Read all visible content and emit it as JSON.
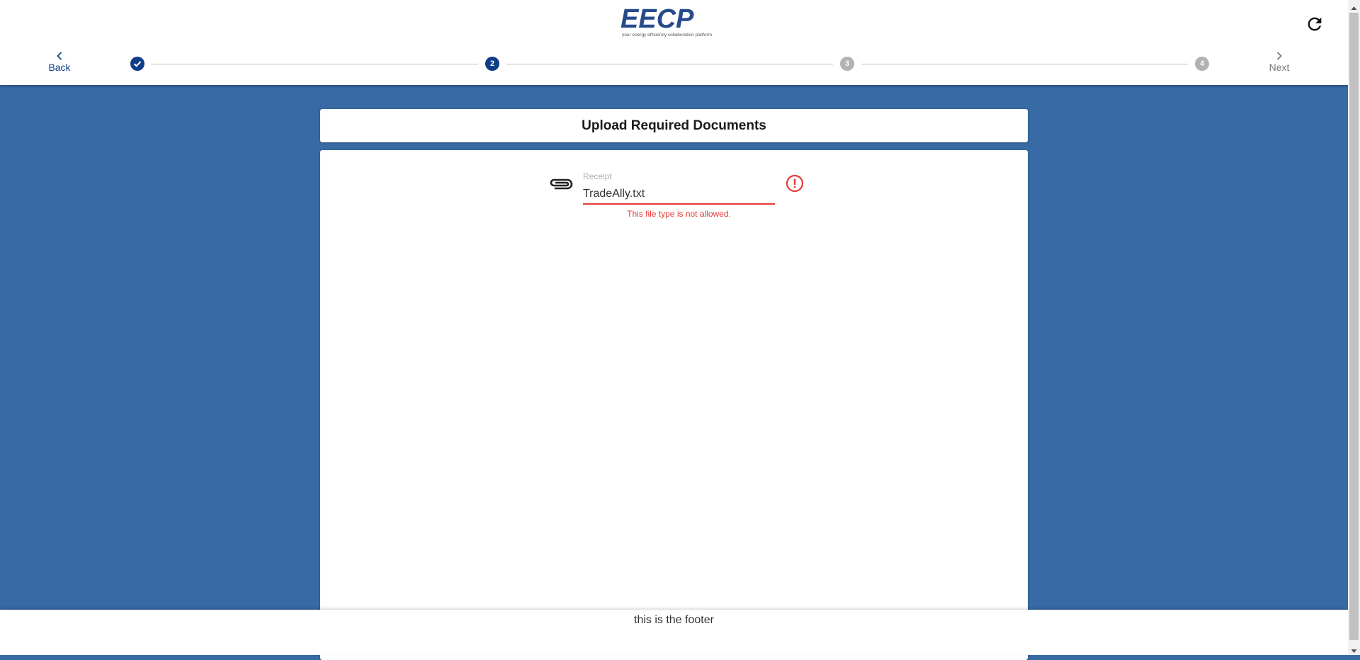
{
  "header": {
    "logo_text": "EECP",
    "logo_tagline": "your energy efficiency collaboration platform",
    "refresh_icon": "refresh-icon"
  },
  "stepper": {
    "back_label": "Back",
    "next_label": "Next",
    "steps": [
      {
        "label": "",
        "state": "done"
      },
      {
        "label": "2",
        "state": "active"
      },
      {
        "label": "3",
        "state": "pending"
      },
      {
        "label": "4",
        "state": "pending"
      }
    ]
  },
  "main": {
    "title": "Upload Required Documents",
    "upload": {
      "label": "Receipt",
      "value": "TradeAlly.txt",
      "error": "This file type is not allowed.",
      "attach_icon": "paperclip-icon",
      "error_icon": "error-icon"
    }
  },
  "footer": {
    "text": "this is the footer"
  },
  "colors": {
    "background": "#386aa5",
    "primary": "#0d3d89",
    "error": "#e53935",
    "pending": "#b2b2b2"
  }
}
